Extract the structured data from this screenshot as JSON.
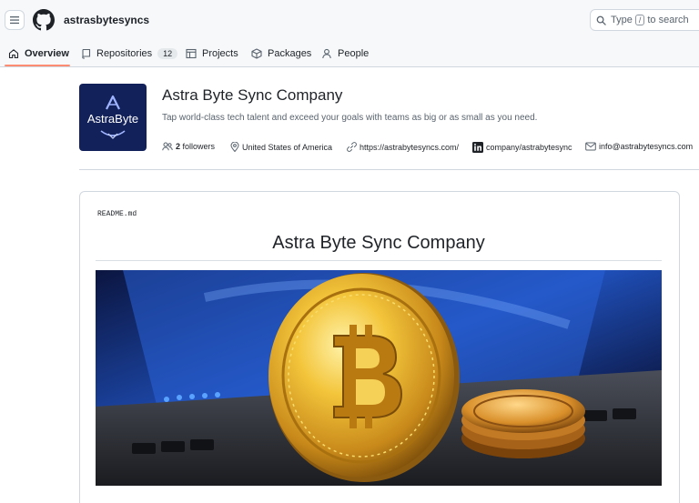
{
  "header": {
    "org_name": "astrasbytesyncs",
    "search_prefix": "Type",
    "search_key": "/",
    "search_suffix": "to search"
  },
  "tabs": [
    {
      "label": "Overview",
      "active": true
    },
    {
      "label": "Repositories",
      "count": "12"
    },
    {
      "label": "Projects"
    },
    {
      "label": "Packages"
    },
    {
      "label": "People"
    }
  ],
  "profile": {
    "avatar_text": "AstraByte",
    "title": "Astra Byte Sync Company",
    "description": "Tap world-class tech talent and exceed your goals with teams as big or as small as you need.",
    "followers_count": "2",
    "followers_label": "followers",
    "location": "United States of America",
    "website": "https://astrabytesyncs.com/",
    "linkedin": "company/astrabytesync",
    "email": "info@astrabytesyncs.com"
  },
  "readme": {
    "filename": "README.md",
    "heading": "Astra Byte Sync Company",
    "image_alt": "bitcoin-on-laptop-image"
  },
  "colors": {
    "header_bg": "#f6f8fa",
    "tab_underline": "#fd8c73",
    "avatar_bg": "#13215a",
    "border": "#d0d7de"
  }
}
